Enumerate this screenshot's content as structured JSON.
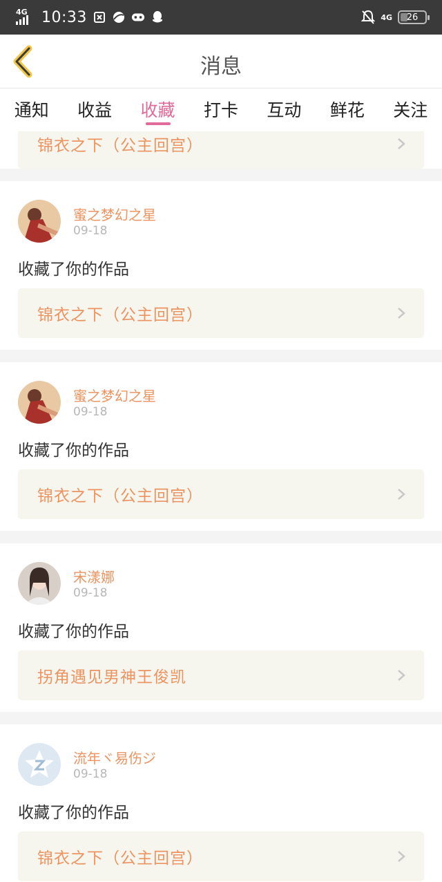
{
  "status_bar": {
    "network_left": "4G",
    "time": "10:33",
    "network_right": "4G",
    "battery": "26",
    "icons": [
      "signal-icon",
      "app-notification-icon",
      "browser-icon",
      "game-controller-icon",
      "qq-icon",
      "mute-bell-icon",
      "battery-icon"
    ]
  },
  "header": {
    "title": "消息",
    "back_icon": "back-chevron-icon"
  },
  "tabs": [
    {
      "label": "通知",
      "active": false
    },
    {
      "label": "收益",
      "active": false
    },
    {
      "label": "收藏",
      "active": true
    },
    {
      "label": "打卡",
      "active": false
    },
    {
      "label": "互动",
      "active": false
    },
    {
      "label": "鲜花",
      "active": false
    },
    {
      "label": "关注",
      "active": false
    }
  ],
  "colors": {
    "accent": "#e06a9a",
    "name": "#ec9461",
    "work_bg": "#f6f6ee",
    "status_bar": "#3a3a3a"
  },
  "partial_item": {
    "work_title": "锦衣之下（公主回宫）"
  },
  "items": [
    {
      "user": "蜜之梦幻之星",
      "date": "09-18",
      "message": "收藏了你的作品",
      "work_title": "锦衣之下（公主回宫）",
      "avatar": "costume-avatar"
    },
    {
      "user": "蜜之梦幻之星",
      "date": "09-18",
      "message": "收藏了你的作品",
      "work_title": "锦衣之下（公主回宫）",
      "avatar": "costume-avatar"
    },
    {
      "user": "宋漾娜",
      "date": "09-18",
      "message": "收藏了你的作品",
      "work_title": "拐角遇见男神王俊凯",
      "avatar": "girl-photo-avatar"
    },
    {
      "user": "流年ヾ易伤ジ",
      "date": "09-18",
      "message": "收藏了你的作品",
      "work_title": "锦衣之下（公主回宫）",
      "avatar": "default-z-avatar"
    }
  ]
}
